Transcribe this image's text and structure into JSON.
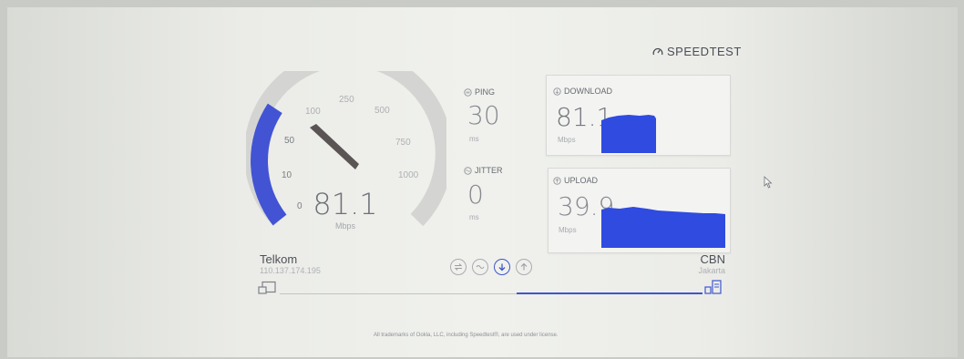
{
  "brand": {
    "logo_text": "SPEEDTEST"
  },
  "gauge": {
    "value": "81.1",
    "unit": "Mbps",
    "ticks": [
      "0",
      "10",
      "50",
      "100",
      "250",
      "500",
      "750",
      "1000"
    ],
    "fill_fraction": 0.39,
    "accent_color": "#3e55d0"
  },
  "ping": {
    "label": "PING",
    "value": "30",
    "unit": "ms"
  },
  "jitter": {
    "label": "JITTER",
    "value": "0",
    "unit": "ms"
  },
  "download": {
    "label": "DOWNLOAD",
    "value": "81.1",
    "unit": "Mbps"
  },
  "upload": {
    "label": "UPLOAD",
    "value": "39.9",
    "unit": "Mbps"
  },
  "client": {
    "isp": "Telkom",
    "ip": "110.137.174.195"
  },
  "server": {
    "name": "CBN",
    "location": "Jakarta"
  },
  "footer": {
    "text": "All trademarks of Ookla, LLC, including Speedtest®, are used under license."
  },
  "colors": {
    "accent": "#3e55d0",
    "graph": "#2f4be0"
  },
  "icons": {
    "brand": "speedometer-icon",
    "ping": "ping-icon",
    "jitter": "jitter-icon",
    "download": "download-icon",
    "upload": "upload-icon",
    "client": "device-icon",
    "server": "server-icon"
  }
}
